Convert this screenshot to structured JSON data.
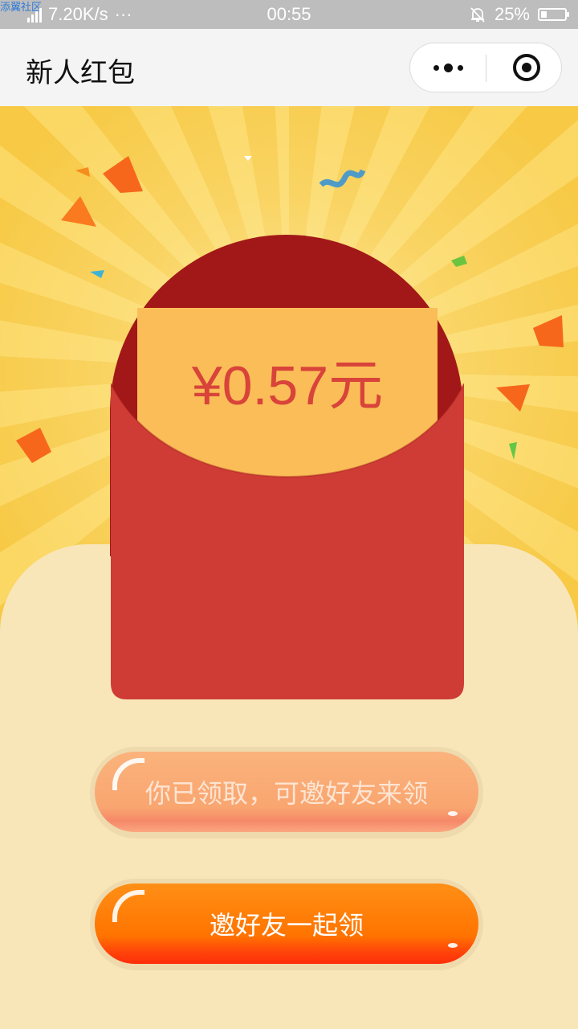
{
  "status_bar": {
    "watermark": "添翼社区",
    "speed": "7.20K/s",
    "more": "···",
    "time": "00:55",
    "battery": "25%",
    "battery_level": 0.25
  },
  "nav": {
    "title": "新人红包"
  },
  "red_packet": {
    "amount": "¥0.57元"
  },
  "buttons": {
    "claimed_label": "你已领取，可邀好友来领",
    "invite_label": "邀好友一起领"
  },
  "colors": {
    "envelope_red": "#cf3b35",
    "envelope_dark": "#a21818",
    "card_yellow": "#fbbd58",
    "amount_text": "#d8433a",
    "button_orange": "#ff7400"
  }
}
